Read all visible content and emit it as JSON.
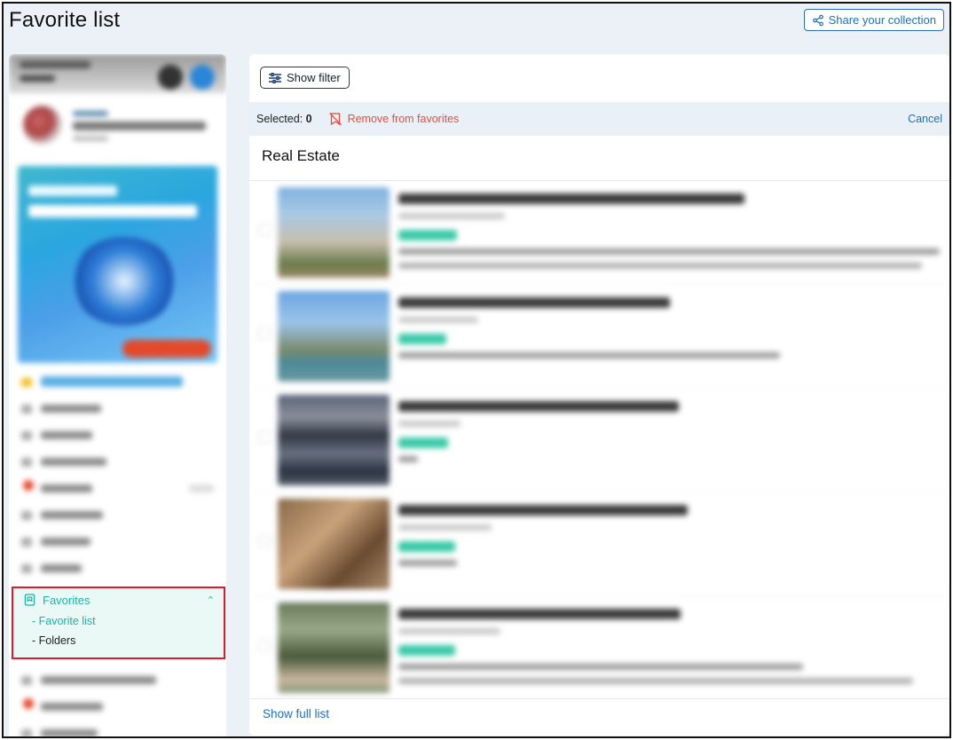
{
  "header": {
    "title": "Favorite list",
    "share_label": "Share your collection",
    "share_icon": "share-icon"
  },
  "sidebar": {
    "favorites": {
      "label": "Favorites",
      "icon": "bookmark-icon",
      "expanded": true,
      "items": [
        {
          "label": "- Favorite list",
          "active": true
        },
        {
          "label": "- Folders",
          "active": false
        }
      ]
    }
  },
  "main": {
    "filter_label": "Show filter",
    "filter_icon": "sliders-icon",
    "selection": {
      "selected_label": "Selected:",
      "selected_count": "0",
      "remove_label": "Remove from favorites",
      "remove_icon": "bookmark-off-icon",
      "cancel_label": "Cancel"
    },
    "section_title": "Real Estate",
    "show_full_label": "Show full list"
  },
  "colors": {
    "accent_teal": "#1bb4a2",
    "link_blue": "#1f6fb7",
    "remove_red": "#e0513d",
    "highlight_border": "#e3192b",
    "page_bg": "#ebf1f6"
  }
}
